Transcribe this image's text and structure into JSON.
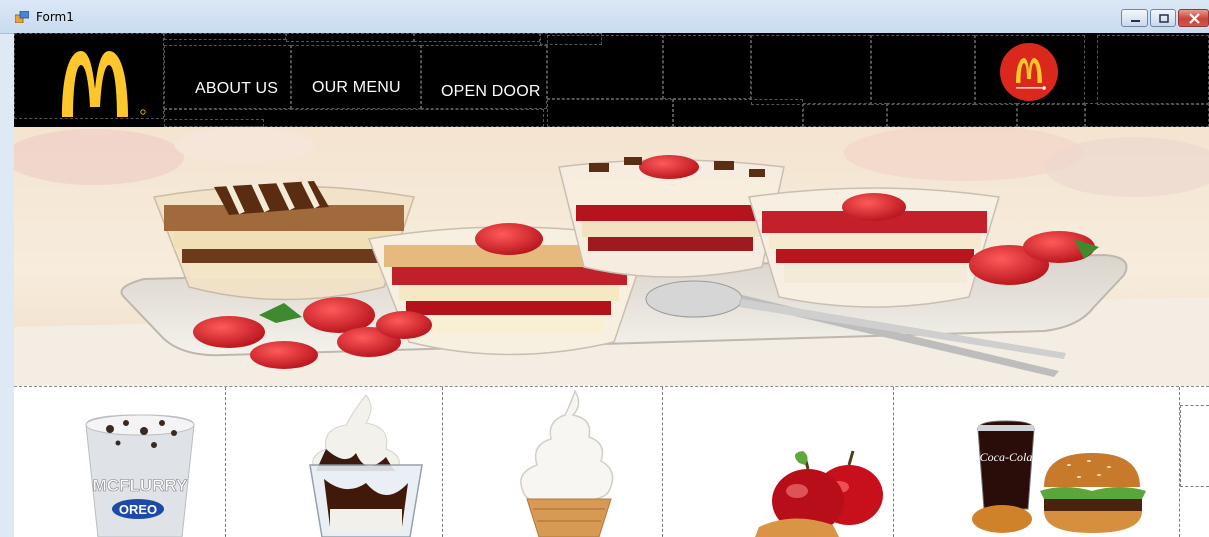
{
  "window": {
    "title": "Form1",
    "controls": [
      "minimize-button",
      "maximize-button",
      "close-button"
    ]
  },
  "nav": {
    "items": [
      {
        "label": "ABOUT US"
      },
      {
        "label": "OUR MENU"
      },
      {
        "label": "OPEN DOOR"
      }
    ]
  },
  "brand": {
    "logo_icon": "golden-arches-logo",
    "badge_icon": "mcdonalds-red-badge-icon",
    "logo_color": "#FFC72C",
    "badge_color": "#DA291C",
    "header_bg": "#000000"
  },
  "hero": {
    "image": "dessert-trifle-banner"
  },
  "products": [
    {
      "image": "mcflurry-oreo",
      "label_1": "MCFLURRY",
      "label_2": "OREO"
    },
    {
      "image": "chocolate-sundae"
    },
    {
      "image": "soft-serve-cone"
    },
    {
      "image": "apples-and-snack"
    },
    {
      "image": "burger-combo",
      "label_1": "Coca-Cola"
    },
    {
      "image": "partial-card"
    }
  ]
}
